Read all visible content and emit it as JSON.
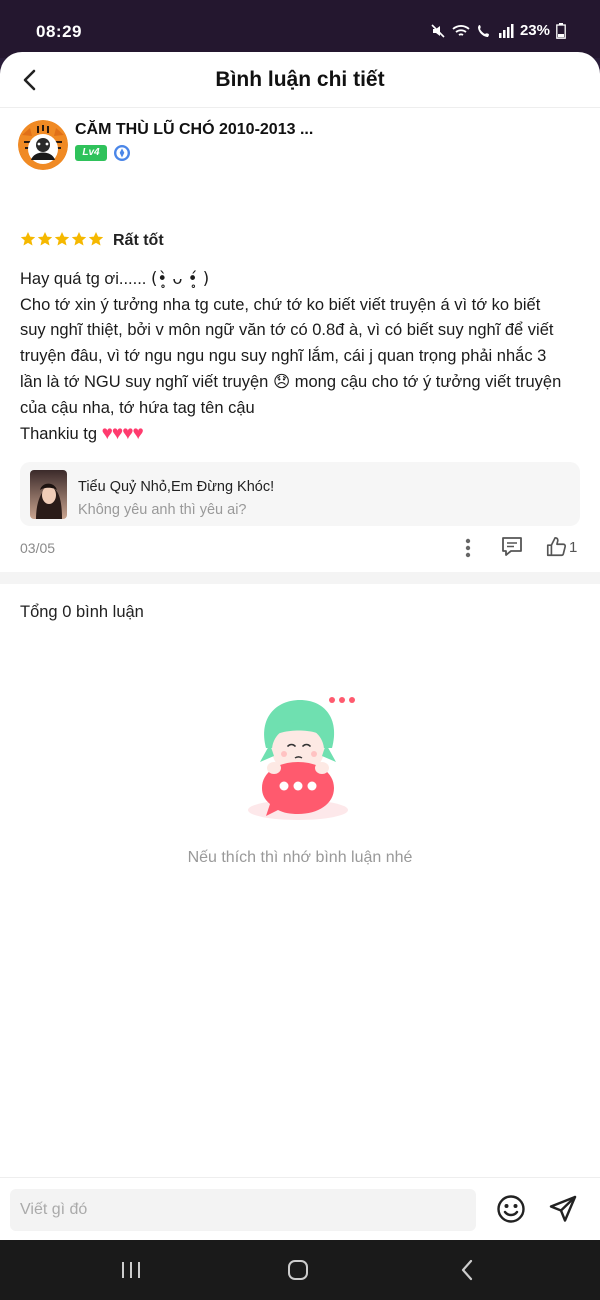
{
  "status_bar": {
    "time": "08:29",
    "battery": "23%",
    "icons": [
      "mute-icon",
      "wifi-icon",
      "wifi-call-icon",
      "signal-icon",
      "battery-icon"
    ]
  },
  "header": {
    "title": "Bình luận chi tiết",
    "back_icon": "chevron-left-icon"
  },
  "comment": {
    "author": {
      "name": "CĂM THÙ LŨ CHÓ 2010-2013 ...",
      "level": "Lv4",
      "verified_icon": "shield-verified-icon"
    },
    "rating": {
      "stars": 5,
      "max": 5,
      "label": "Rất tốt",
      "color": "#f5b800"
    },
    "body": {
      "line1_text": "Hay quá tg ơi...... ",
      "line1_emoticon": "(•̥̀ ᴗ •̥́ )",
      "line2": "Cho tớ xin ý tưởng nha tg cute, chứ tớ ko biết viết truyện á vì tớ ko biết",
      "line3": "suy nghĩ thiệt, bởi v môn ngữ văn tớ có 0.8đ à, vì có biết suy nghĩ để viết",
      "line4": "truyện đâu, vì tớ ngu ngu ngu suy nghĩ lắm, cái j quan trọng phải nhắc 3",
      "line5_a": "lần là tớ NGU suy nghĩ viết truyện ",
      "line5_emoji": "😞",
      "line5_b": " mong cậu cho tớ ý tưởng viết truyện",
      "line6": "của cậu nha, tớ hứa tag tên cậu",
      "line7_text": "Thankiu tg ",
      "line7_hearts": "♥♥♥♥"
    },
    "book": {
      "title": "Tiểu Quỷ Nhỏ,Em Đừng Khóc!",
      "subtitle": "Không yêu anh thì yêu ai?"
    },
    "date": "03/05",
    "likes": "1"
  },
  "comments_section": {
    "total_label": "Tổng 0 bình luận",
    "empty_text": "Nếu thích thì nhớ bình luận nhé"
  },
  "input_bar": {
    "placeholder": "Viết gì đó"
  },
  "colors": {
    "accent_green": "#2fc25b",
    "bubble_red": "#ff5a6e",
    "hair_green": "#6fe0b0"
  }
}
